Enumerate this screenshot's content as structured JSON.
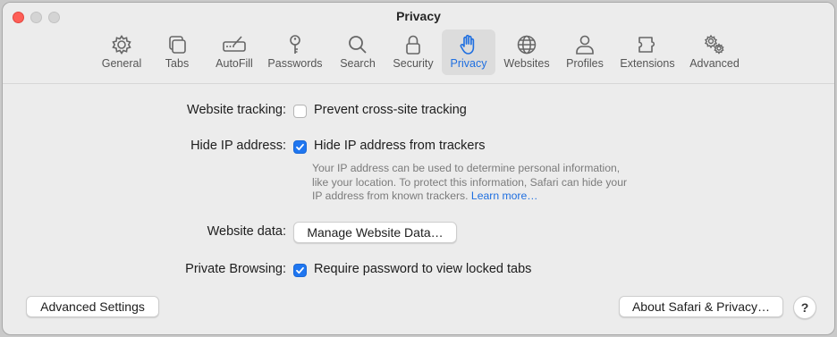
{
  "window": {
    "title": "Privacy"
  },
  "toolbar": {
    "tabs": [
      {
        "label": "General",
        "icon": "gear-icon"
      },
      {
        "label": "Tabs",
        "icon": "tabs-icon"
      },
      {
        "label": "AutoFill",
        "icon": "autofill-icon"
      },
      {
        "label": "Passwords",
        "icon": "key-icon"
      },
      {
        "label": "Search",
        "icon": "search-icon"
      },
      {
        "label": "Security",
        "icon": "lock-icon"
      },
      {
        "label": "Privacy",
        "icon": "hand-icon",
        "selected": true
      },
      {
        "label": "Websites",
        "icon": "globe-icon"
      },
      {
        "label": "Profiles",
        "icon": "person-icon"
      },
      {
        "label": "Extensions",
        "icon": "puzzle-icon"
      },
      {
        "label": "Advanced",
        "icon": "gears-icon"
      }
    ]
  },
  "settings": {
    "website_tracking": {
      "label": "Website tracking:",
      "option": "Prevent cross-site tracking",
      "checked": false
    },
    "hide_ip": {
      "label": "Hide IP address:",
      "option": "Hide IP address from trackers",
      "checked": true,
      "description_line1": "Your IP address can be used to determine personal information,",
      "description_line2": "like your location. To protect this information, Safari can hide your",
      "description_line3": "IP address from known trackers.",
      "learn_more": "Learn more…"
    },
    "website_data": {
      "label": "Website data:",
      "button": "Manage Website Data…"
    },
    "private_browsing": {
      "label": "Private Browsing:",
      "option": "Require password to view locked tabs",
      "checked": true
    }
  },
  "footer": {
    "advanced_settings": "Advanced Settings",
    "about": "About Safari & Privacy…",
    "help": "?"
  },
  "colors": {
    "accent": "#1f76f0",
    "link": "#1f6fe0",
    "close": "#fe5f57"
  }
}
